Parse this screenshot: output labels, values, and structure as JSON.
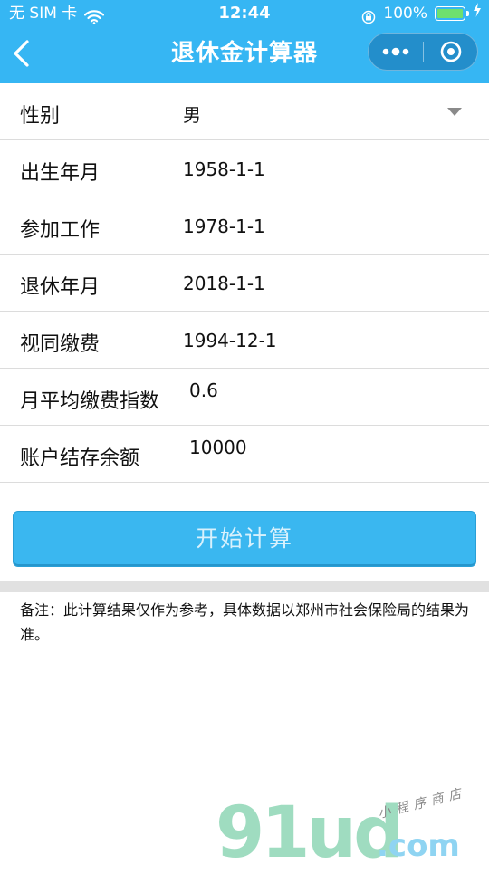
{
  "status_bar": {
    "carrier": "无 SIM 卡",
    "time": "12:44",
    "battery": "100%"
  },
  "nav": {
    "title": "退休金计算器"
  },
  "form": {
    "rows": [
      {
        "label": "性别",
        "value": "男"
      },
      {
        "label": "出生年月",
        "value": "1958-1-1"
      },
      {
        "label": "参加工作",
        "value": "1978-1-1"
      },
      {
        "label": "退休年月",
        "value": "2018-1-1"
      },
      {
        "label": "视同缴费",
        "value": "1994-12-1"
      },
      {
        "label": "月平均缴费指数",
        "value": "0.6"
      },
      {
        "label": "账户结存余额",
        "value": "10000"
      }
    ]
  },
  "button": {
    "label": "开始计算"
  },
  "note": {
    "text": "备注：此计算结果仅作为参考，具体数据以郑州市社会保险局的结果为准。"
  },
  "watermark": {
    "brand": "91ud",
    "tld": ".com",
    "tagline": "小程序商店"
  },
  "colors": {
    "header_bg": "#36b6f3",
    "button_bg": "#3ab7f0"
  },
  "icons": [
    "wifi-icon",
    "lock-rotation-icon",
    "charge-icon",
    "battery-icon",
    "back-icon",
    "more-icon",
    "close-icon",
    "dropdown-arrow-icon"
  ]
}
